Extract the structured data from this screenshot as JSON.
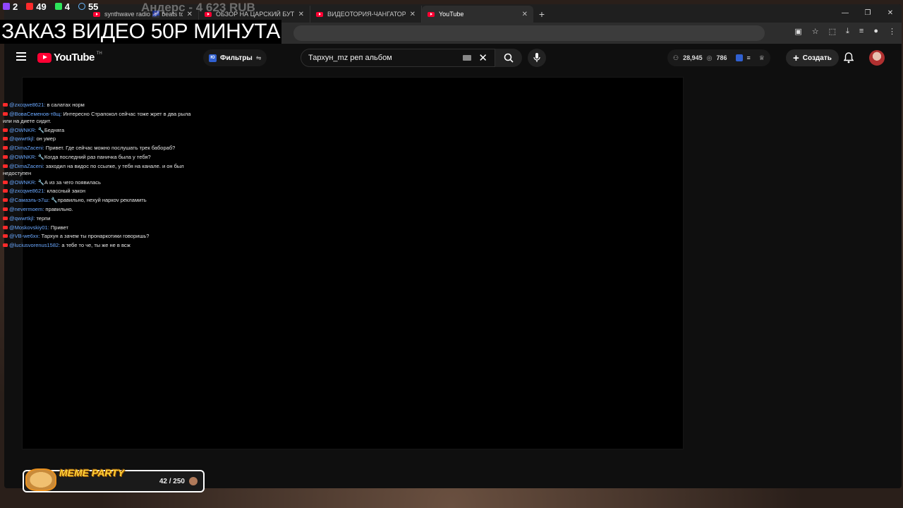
{
  "stream_top": {
    "twitch_count": "2",
    "youtube_count": "49",
    "kick_count": "4",
    "viewers_count": "55"
  },
  "donation_text": "Андерс - 4 623 RUB",
  "order_banner": "ЗАКАЗ ВИДЕО 50Р МИНУТА",
  "tabs": [
    {
      "title": "synthwave radio 🌌 beats to"
    },
    {
      "title": "ОБЗОР НА ЦАРСКИЙ БУТЕРБ"
    },
    {
      "title": "ВИДЕОТОРИЯ-ЧАНГАТОРИЯ"
    },
    {
      "title": "YouTube"
    }
  ],
  "youtube": {
    "logo_text": "YouTube",
    "logo_sup": "TH",
    "filters_label": "Фильтры",
    "search_value": "Тархун_mz реп альбом",
    "stat_views": "28,945",
    "stat_watch": "786",
    "create_label": "Создать"
  },
  "chat": [
    {
      "user": "@zxcqwe8621:",
      "text": " в салатах норм"
    },
    {
      "user": "@ВоваСеменов-т8щ:",
      "text": " Интересно Страпокол сейчас тоже жрет в два рыла или на диете сидит."
    },
    {
      "user": "@OWNKR:",
      "text": " 🔧Бедняга"
    },
    {
      "user": "@qwwrtkjl:",
      "text": " он умер"
    },
    {
      "user": "@DimaZaceni:",
      "text": " Привет. Где сейчас можно послушать трек бабораб?"
    },
    {
      "user": "@OWNKR:",
      "text": " 🔧Когда последний раз паничка была у тебя?"
    },
    {
      "user": "@DimaZaceni:",
      "text": " заходил на видос по ссылке, у тебя на канале. и он был недоступен"
    },
    {
      "user": "@OWNKR:",
      "text": " 🔧А из за чего появилась"
    },
    {
      "user": "@zxcqwe8621:",
      "text": " классный закон"
    },
    {
      "user": "@Самаэль-э7ш:",
      "text": " 🔧правильно, нехуй наркоv рекламить"
    },
    {
      "user": "@nevermoem:",
      "text": " правильно."
    },
    {
      "user": "@qwwrtkjl:",
      "text": " терпи"
    },
    {
      "user": "@Moskovskiy01:",
      "text": " Привет"
    },
    {
      "user": "@VB-we6xx:",
      "text": " Тархун а зачем ты пронаркотики говоришь?"
    },
    {
      "user": "@luciusvorenus1582:",
      "text": " а тебе то че, ты же не в всж"
    }
  ],
  "meme_party": {
    "label": "MEME PARTY",
    "count": "42 / 250"
  }
}
